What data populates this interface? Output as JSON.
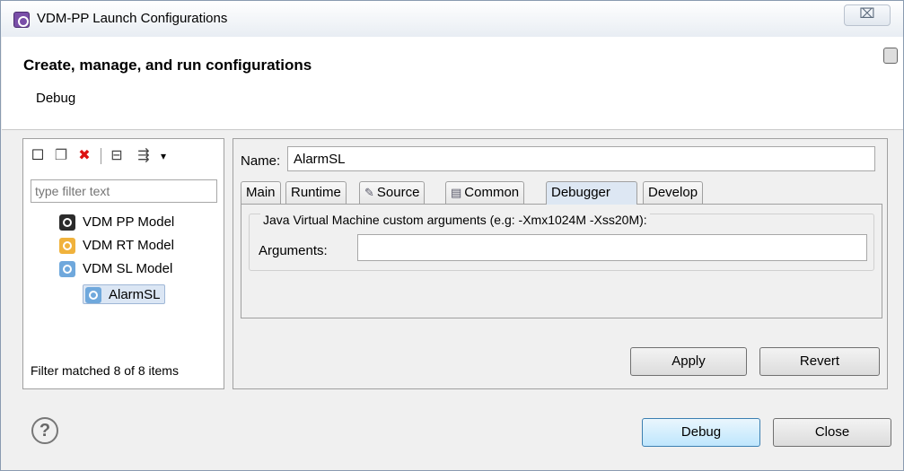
{
  "window": {
    "title": "VDM-PP Launch Configurations",
    "close_glyph": "⌧"
  },
  "header": {
    "title": "Create, manage, and run configurations",
    "subtitle": "Debug"
  },
  "left_panel": {
    "toolbar": {
      "new_icon": "new-config-icon",
      "duplicate_icon": "duplicate-icon",
      "delete_icon": "delete-icon",
      "collapse_icon": "collapse-all-icon",
      "filter_icon": "filter-icon",
      "new_glyph": "☐",
      "duplicate_glyph": "❐",
      "delete_glyph": "✖",
      "collapse_glyph": "⊟",
      "filter_glyph": "⇶",
      "menu_glyph": "▾"
    },
    "filter_placeholder": "type filter text",
    "tree": [
      {
        "label": "VDM PP Model",
        "color": "#2b2b2b"
      },
      {
        "label": "VDM RT Model",
        "color": "#f0b23c"
      },
      {
        "label": "VDM SL Model",
        "color": "#6fa8dc"
      },
      {
        "label": "AlarmSL",
        "color": "#6fa8dc"
      }
    ],
    "status": "Filter matched 8 of 8 items"
  },
  "right_panel": {
    "name_label": "Name:",
    "name_value": "AlarmSL",
    "tabs": [
      {
        "label": "Main"
      },
      {
        "label": "Runtime"
      },
      {
        "label": "Source",
        "icon_glyph": "✎"
      },
      {
        "label": "Common",
        "icon_glyph": "▤"
      },
      {
        "label": "Debugger"
      },
      {
        "label": "Develop"
      }
    ],
    "group_label": "Java Virtual Machine custom arguments (e.g: -Xmx1024M -Xss20M):",
    "arguments_label": "Arguments:",
    "arguments_value": "",
    "apply_label": "Apply",
    "revert_label": "Revert"
  },
  "footer": {
    "help_glyph": "?",
    "debug_label": "Debug",
    "close_label": "Close"
  }
}
